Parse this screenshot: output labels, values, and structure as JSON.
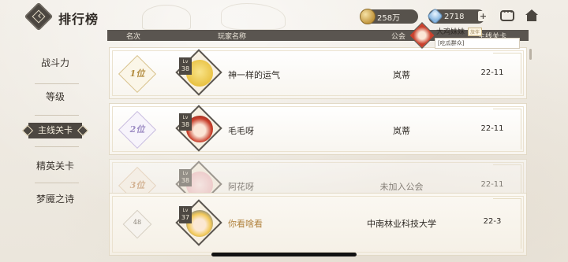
{
  "header": {
    "title": "排行榜",
    "gold_amount": "258万",
    "gem_amount": "2718",
    "plus_label": "+"
  },
  "sidebar": {
    "items": [
      {
        "label": "战斗力"
      },
      {
        "label": "等级"
      },
      {
        "label": "主线关卡",
        "active": true
      },
      {
        "label": "精英关卡"
      },
      {
        "label": "梦魇之诗"
      }
    ]
  },
  "table": {
    "columns": [
      "名次",
      "玩家名称",
      "公会",
      "主线关卡"
    ],
    "rows": [
      {
        "rank": "1位",
        "level_label": "Lv",
        "level": "38",
        "name": "神一样的运气",
        "guild": "岚蒂",
        "stage": "22-11"
      },
      {
        "rank": "2位",
        "level_label": "Lv",
        "level": "38",
        "name": "毛毛呀",
        "guild": "岚蒂",
        "stage": "22-11"
      },
      {
        "rank": "3位",
        "level_label": "Lv",
        "level": "38",
        "name": "阿花呀",
        "guild": "未加入公会",
        "stage": "22-11"
      }
    ],
    "self_row": {
      "rank": "48",
      "level_label": "Lv",
      "level": "37",
      "name": "你看啥看",
      "guild": "中南林业科技大学",
      "stage": "22-3"
    }
  },
  "popup": {
    "name": "大鸡妹妹",
    "tag": "旅伴",
    "subtitle": "[吃瓜群众]"
  }
}
